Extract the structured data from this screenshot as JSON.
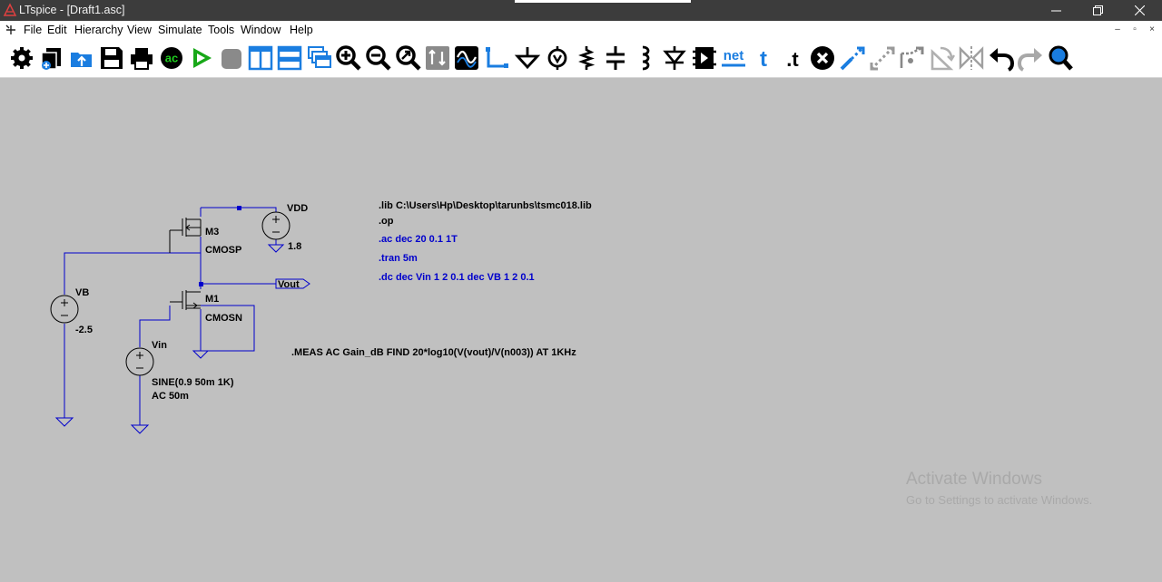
{
  "window": {
    "title": "LTspice - [Draft1.asc]",
    "controls": [
      {
        "name": "minimize-button",
        "icon": "minimize-icon"
      },
      {
        "name": "restore-button",
        "icon": "restore-icon"
      },
      {
        "name": "close-button",
        "icon": "close-icon"
      }
    ]
  },
  "menu": {
    "items": [
      "File",
      "Edit",
      "Hierarchy",
      "View",
      "Simulate",
      "Tools",
      "Window",
      "Help"
    ],
    "mdi_controls": [
      "–",
      "▫",
      "×"
    ]
  },
  "toolbar": {
    "buttons": [
      {
        "name": "control-panel",
        "icon": "gear-icon"
      },
      {
        "name": "new-schematic",
        "icon": "new-schematic-icon"
      },
      {
        "name": "open",
        "icon": "open-folder-icon"
      },
      {
        "name": "save",
        "icon": "floppy-icon"
      },
      {
        "name": "print",
        "icon": "printer-icon"
      },
      {
        "name": "ac-analysis",
        "icon": "ac-icon",
        "label": "ac"
      },
      {
        "name": "run",
        "icon": "run-icon"
      },
      {
        "name": "halt",
        "icon": "halt-icon"
      },
      {
        "name": "tile-vertical",
        "icon": "tile-vertical-icon"
      },
      {
        "name": "tile-horizontal",
        "icon": "tile-horizontal-icon"
      },
      {
        "name": "cascade",
        "icon": "cascade-icon"
      },
      {
        "name": "zoom-in",
        "icon": "zoom-in-icon"
      },
      {
        "name": "zoom-out",
        "icon": "zoom-out-icon"
      },
      {
        "name": "zoom-fit",
        "icon": "zoom-fit-icon"
      },
      {
        "name": "autoscale",
        "icon": "autoscale-icon"
      },
      {
        "name": "waveform",
        "icon": "waveform-icon"
      },
      {
        "name": "draw-wire",
        "icon": "wire-icon"
      },
      {
        "name": "place-ground",
        "icon": "ground-icon"
      },
      {
        "name": "place-voltage",
        "icon": "voltage-source-icon"
      },
      {
        "name": "place-resistor",
        "icon": "resistor-icon"
      },
      {
        "name": "place-capacitor",
        "icon": "capacitor-icon"
      },
      {
        "name": "place-inductor",
        "icon": "inductor-icon"
      },
      {
        "name": "place-diode",
        "icon": "diode-icon"
      },
      {
        "name": "place-component",
        "icon": "component-icon"
      },
      {
        "name": "label-net",
        "icon": "net-label-icon",
        "label": "net"
      },
      {
        "name": "place-text",
        "icon": "text-icon",
        "label": "t"
      },
      {
        "name": "spice-directive",
        "icon": "spice-directive-icon",
        "label": ".t"
      },
      {
        "name": "delete",
        "icon": "delete-icon"
      },
      {
        "name": "duplicate",
        "icon": "duplicate-icon"
      },
      {
        "name": "move",
        "icon": "move-icon"
      },
      {
        "name": "drag",
        "icon": "drag-icon"
      },
      {
        "name": "rotate",
        "icon": "rotate-icon"
      },
      {
        "name": "mirror",
        "icon": "mirror-icon"
      },
      {
        "name": "undo",
        "icon": "undo-icon"
      },
      {
        "name": "redo",
        "icon": "redo-icon"
      },
      {
        "name": "find",
        "icon": "find-icon"
      }
    ]
  },
  "schematic": {
    "labels": {
      "vdd_name": "VDD",
      "vdd_value": "1.8",
      "m3_name": "M3",
      "m3_model": "CMOSP",
      "m1_name": "M1",
      "m1_model": "CMOSN",
      "vb_name": "VB",
      "vb_value": "-2.5",
      "vin_name": "Vin",
      "vin_value1": "SINE(0.9 50m 1K)",
      "vin_value2": "AC 50m",
      "vout_label": "Vout"
    },
    "directives": {
      "lib": ".lib C:\\Users\\Hp\\Desktop\\tarunbs\\tsmc018.lib",
      "op": ".op",
      "ac": ".ac dec 20 0.1 1T",
      "tran": ".tran 5m",
      "dc": ".dc dec Vin 1 2 0.1 dec VB 1 2 0.1",
      "meas": ".MEAS AC Gain_dB FIND 20*log10(V(vout)/V(n003)) AT 1KHz"
    }
  },
  "watermark": {
    "title": "Activate Windows",
    "subtitle": "Go to Settings to activate Windows."
  },
  "colors": {
    "canvas": "#c0c0c0",
    "wire": "#0000cc",
    "directive": "#0000cc",
    "titlebar": "#3c3c3c",
    "toolbar_icon": "#000000",
    "toolbar_accent": "#1a7de0",
    "run_green": "#18a818"
  }
}
